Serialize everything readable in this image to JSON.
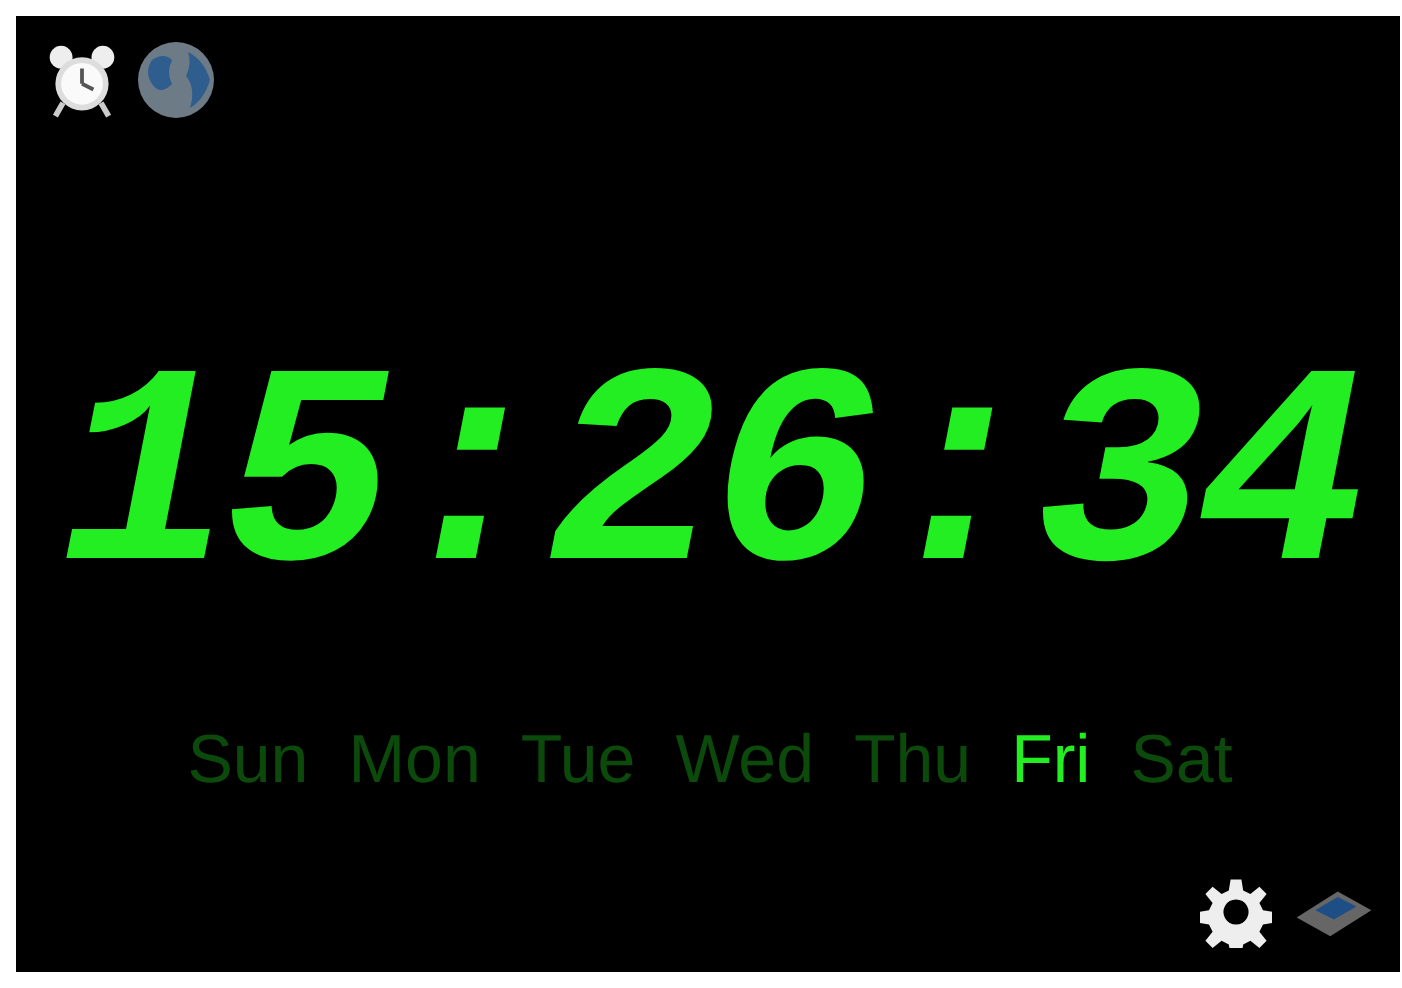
{
  "clock": {
    "time": "15:26:34"
  },
  "weekdays": [
    {
      "label": "Sun",
      "selected": false
    },
    {
      "label": "Mon",
      "selected": false
    },
    {
      "label": "Tue",
      "selected": false
    },
    {
      "label": "Wed",
      "selected": false
    },
    {
      "label": "Thu",
      "selected": false
    },
    {
      "label": "Fri",
      "selected": true
    },
    {
      "label": "Sat",
      "selected": false
    }
  ]
}
